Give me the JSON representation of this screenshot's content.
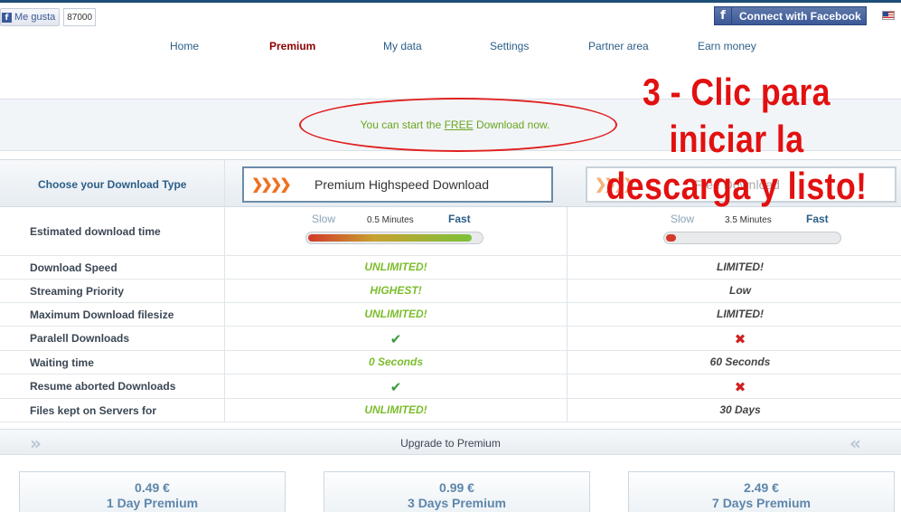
{
  "facebook": {
    "like_label": "Me gusta",
    "like_count": "87000",
    "connect_label": "Connect with Facebook"
  },
  "language_flag": "us-flag-icon",
  "nav": {
    "home": "Home",
    "premium": "Premium",
    "my_data": "My data",
    "settings": "Settings",
    "partner_area": "Partner area",
    "earn_money": "Earn money"
  },
  "notice": {
    "before": "You can start the ",
    "link": "FREE",
    "after": " Download now."
  },
  "overlay": {
    "line1": "3 - Clic para",
    "line2": "iniciar la",
    "line3": "descarga y listo!"
  },
  "table": {
    "choose_label": "Choose your Download Type",
    "premium_button": "Premium Highspeed Download",
    "free_button": "Free Download",
    "est_time_label": "Estimated download time",
    "premium_speed": {
      "slow": "Slow",
      "fast": "Fast",
      "minutes": "0.5 Minutes",
      "level": 0.95
    },
    "free_speed": {
      "slow": "Slow",
      "fast": "Fast",
      "minutes": "3.5 Minutes",
      "level": 0.06
    },
    "rows": [
      {
        "label": "Download Speed",
        "premium": "UNLIMITED!",
        "free": "LIMITED!"
      },
      {
        "label": "Streaming Priority",
        "premium": "HIGHEST!",
        "free": "Low"
      },
      {
        "label": "Maximum Download filesize",
        "premium": "UNLIMITED!",
        "free": "LIMITED!"
      },
      {
        "label": "Paralell Downloads",
        "premium": "check-icon",
        "free": "cross-icon"
      },
      {
        "label": "Waiting time",
        "premium": "0 Seconds",
        "free": "60 Seconds"
      },
      {
        "label": "Resume aborted Downloads",
        "premium": "check-icon",
        "free": "cross-icon"
      },
      {
        "label": "Files kept on Servers for",
        "premium": "UNLIMITED!",
        "free": "30 Days"
      }
    ]
  },
  "upgrade": {
    "label": "Upgrade to Premium"
  },
  "plans": [
    {
      "price": "0.49 €",
      "name": "1 Day Premium"
    },
    {
      "price": "0.99 €",
      "name": "3 Days Premium"
    },
    {
      "price": "2.49 €",
      "name": "7 Days Premium"
    }
  ],
  "colors": {
    "accent_green": "#7cbd2c",
    "link_blue": "#2b5e88",
    "overlay_red": "#e21010",
    "facebook_blue": "#3b5998"
  }
}
